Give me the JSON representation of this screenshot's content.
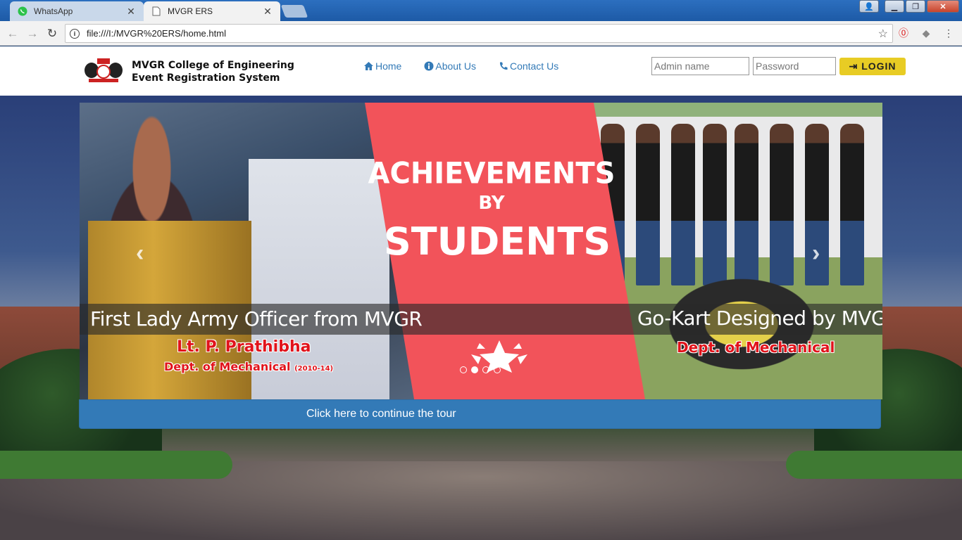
{
  "browser": {
    "tabs": [
      {
        "label": "WhatsApp",
        "icon": "whatsapp-icon",
        "active": false
      },
      {
        "label": "MVGR ERS",
        "icon": "page-icon",
        "active": true
      }
    ],
    "address": "file:///I:/MVGR%20ERS/home.html"
  },
  "header": {
    "brand_line1": "MVGR College of Engineering",
    "brand_line2": "Event Registration System",
    "nav": [
      {
        "label": "Home",
        "icon": "home-icon"
      },
      {
        "label": "About Us",
        "icon": "info-icon"
      },
      {
        "label": "Contact Us",
        "icon": "phone-icon"
      }
    ],
    "login": {
      "admin_placeholder": "Admin name",
      "password_placeholder": "Password",
      "button_label": "LOGIN"
    }
  },
  "carousel": {
    "headline_top": "ACHIEVEMENTS",
    "headline_by": "BY",
    "headline_bottom": "STUDENTS",
    "caption_left": "First Lady Army Officer from MVGR",
    "name_left": "Lt. P. Prathibha",
    "dept_left": "Dept. of Mechanical",
    "dept_left_years": "(2010-14)",
    "caption_right": "Go-Kart Designed by MVGR",
    "dept_right": "Dept. of Mechanical",
    "indicator_count": 4,
    "active_indicator": 2
  },
  "tour_button": "Click here to continue the tour",
  "colors": {
    "accent_blue": "#337ab7",
    "login_yellow": "#e8cc24",
    "banner_red": "#f2535a"
  }
}
